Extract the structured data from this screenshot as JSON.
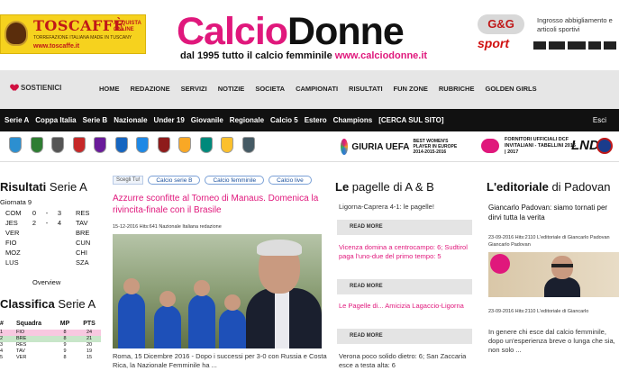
{
  "ads": {
    "left": {
      "brand": "TOSCAFFÈ",
      "tagline": "TORREFAZIONE ITALIANA MADE IN TUSCANY",
      "url": "www.toscaffe.it",
      "side": "ACQUISTA ONLINE"
    },
    "right": {
      "logo": "G&G",
      "name": "sport",
      "desc": "Ingrosso abbigliamento e articoli sportivi"
    }
  },
  "site": {
    "logo_part1": "Calcio",
    "logo_part2": "Donne",
    "tagline": "dal 1995 tutto il calcio femminile",
    "url": "www.calciodonne.it"
  },
  "menu": {
    "sostienici": "SOSTIENICI",
    "items": [
      "HOME",
      "REDAZIONE",
      "SERVIZI",
      "NOTIZIE",
      "SOCIETA",
      "CAMPIONATI",
      "RISULTATI",
      "FUN ZONE",
      "RUBRICHE",
      "GOLDEN GIRLS"
    ]
  },
  "subnav": {
    "items": [
      "Serie A",
      "Coppa Italia",
      "Serie B",
      "Nazionale",
      "Under 19",
      "Giovanile",
      "Regionale",
      "Calcio 5",
      "Estero",
      "Champions",
      "[CERCA SUL SITO]"
    ],
    "esci": "Esci"
  },
  "sponsors": {
    "uefa_name": "GIURIA UEFA",
    "uefa_sub": "BEST WOMEN'S PLAYER IN EUROPE 2014-2015-2016",
    "fornitori": "FORNITORI UFFICIALI DCF INVITALIANI - TABELLINI 2016 | 2017",
    "lnd": "LND",
    "colors": [
      "#2c8fd0",
      "#2e7d32",
      "#555555",
      "#c62828",
      "#6a1b9a",
      "#1565c0",
      "#1e88e5",
      "#8e1b1b",
      "#f9a825",
      "#00897b",
      "#fbc02d",
      "#455a64"
    ]
  },
  "results": {
    "title_bold": "Risultati",
    "title_rest": " Serie A",
    "giornata": "Giornata 9",
    "rows": [
      {
        "home": "COM",
        "s1": "0",
        "s2": "3",
        "away": "RES"
      },
      {
        "home": "JES",
        "s1": "2",
        "s2": "4",
        "away": "TAV"
      },
      {
        "home": "VER",
        "s1": "",
        "s2": "",
        "away": "BRE"
      },
      {
        "home": "FIO",
        "s1": "",
        "s2": "",
        "away": "CUN"
      },
      {
        "home": "MOZ",
        "s1": "",
        "s2": "",
        "away": "CHI"
      },
      {
        "home": "LUS",
        "s1": "",
        "s2": "",
        "away": "SZA"
      }
    ],
    "overview": "Overview"
  },
  "standings": {
    "title_bold": "Classifica",
    "title_rest": " Serie A",
    "headers": {
      "pos": "#",
      "team": "Squadra",
      "mp": "MP",
      "pts": "PTS"
    },
    "rows": [
      {
        "pos": "1",
        "team": "FIO",
        "mp": "8",
        "pts": "24",
        "color": "#f8c8e0"
      },
      {
        "pos": "2",
        "team": "BRE",
        "mp": "8",
        "pts": "21",
        "color": "#c8e6c9"
      },
      {
        "pos": "3",
        "team": "RES",
        "mp": "9",
        "pts": "20",
        "color": "#ffffff"
      },
      {
        "pos": "4",
        "team": "TAV",
        "mp": "9",
        "pts": "19",
        "color": "#ffffff"
      },
      {
        "pos": "5",
        "team": "VER",
        "mp": "8",
        "pts": "15",
        "color": "#ffffff"
      }
    ]
  },
  "article": {
    "scegli": "Scegli Tu!",
    "chips": [
      "Calcio serie B",
      "Calcio femminile",
      "Calcio live"
    ],
    "headline": "Azzurre sconfitte al Torneo di Manaus. Domenica la rivincita-finale con il Brasile",
    "meta": "15-12-2016 Hits:641 Nazionale Italiana redazione",
    "excerpt": "Roma, 15 Dicembre 2016 - Dopo i successi per 3-0 con Russia e Costa Rica, la Nazionale Femminile ha ..."
  },
  "pagelle": {
    "title_bold": "Le",
    "title_rest": " pagelle di A & B",
    "items": [
      {
        "text": "Ligorna-Caprera 4-1: le pagelle!",
        "pink": false
      },
      {
        "text": "Vicenza domina a centrocampo: 6; Sudtirol paga l'uno-due del primo tempo: 5",
        "pink": true
      },
      {
        "text": "Le Pagelle di... Amicizia Lagaccio-Ligorna",
        "pink": true
      },
      {
        "text": "Verona poco solido dietro: 6; San Zaccaria esce a testa alta: 6",
        "pink": false
      }
    ],
    "read_more": "READ MORE"
  },
  "editoriale": {
    "title_bold": "L'editoriale",
    "title_rest": " di Padovan",
    "headline": "Giancarlo Padovan: siamo tornati per dirvi tutta la verita",
    "meta": "23-09-2016 Hits:2110 L'editoriale di Giancarlo Padovan Giancarlo Padovan",
    "meta2": "23-09-2016 Hits:2110 L'editoriale di Giancarlo",
    "text": "In genere chi esce dal calcio femminile, dopo un'esperienza breve o lunga che sia, non solo ..."
  }
}
